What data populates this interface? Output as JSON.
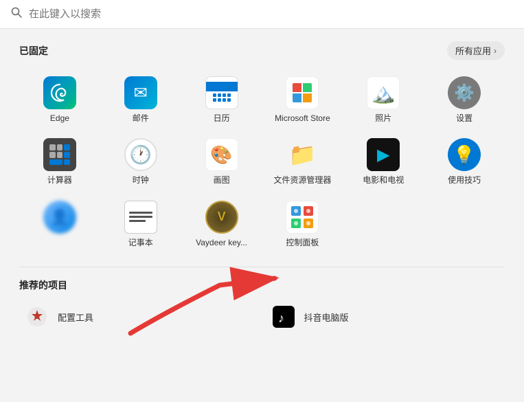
{
  "search": {
    "placeholder": "在此键入以搜索"
  },
  "pinned_section": {
    "title": "已固定",
    "all_apps_label": "所有应用"
  },
  "apps": [
    {
      "id": "edge",
      "label": "Edge"
    },
    {
      "id": "mail",
      "label": "邮件"
    },
    {
      "id": "calendar",
      "label": "日历"
    },
    {
      "id": "store",
      "label": "Microsoft Store"
    },
    {
      "id": "photos",
      "label": "照片"
    },
    {
      "id": "settings",
      "label": "设置"
    },
    {
      "id": "calculator",
      "label": "计算器"
    },
    {
      "id": "clock",
      "label": "时钟"
    },
    {
      "id": "paint",
      "label": "画图"
    },
    {
      "id": "explorer",
      "label": "文件资源管理器"
    },
    {
      "id": "movies",
      "label": "电影和电视"
    },
    {
      "id": "tips",
      "label": "使用技巧"
    },
    {
      "id": "avatar",
      "label": ""
    },
    {
      "id": "notepad",
      "label": "记事本"
    },
    {
      "id": "vaydeer",
      "label": "Vaydeer key..."
    },
    {
      "id": "control-panel",
      "label": "控制面板"
    }
  ],
  "recommended_section": {
    "title": "推荐的项目"
  },
  "recommended": [
    {
      "id": "config-tool",
      "label": "配置工具",
      "icon": "⚙️"
    },
    {
      "id": "douyin",
      "label": "抖音电脑版",
      "icon": "🎵"
    }
  ]
}
